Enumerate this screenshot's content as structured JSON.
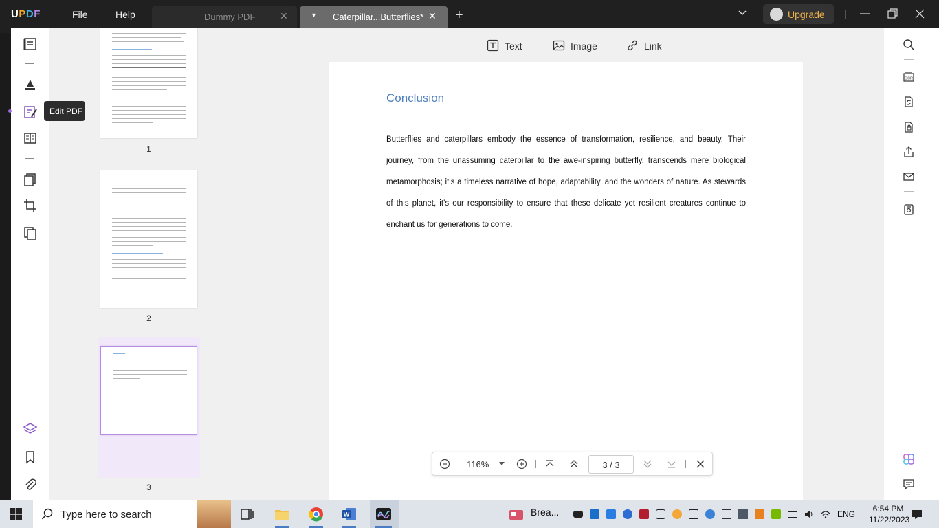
{
  "titlebar": {
    "logo": "UPDF",
    "menus": [
      "File",
      "Help"
    ],
    "tabs": [
      {
        "label": "Dummy PDF",
        "active": false
      },
      {
        "label": "Caterpillar...Butterflies*",
        "active": true
      }
    ],
    "upgrade_label": "Upgrade"
  },
  "rail": {
    "tooltip": "Edit PDF",
    "active_tool": "edit-pdf"
  },
  "thumbnails": {
    "pages": [
      "1",
      "2",
      "3"
    ],
    "selected": "3"
  },
  "toolbar": {
    "text_label": "Text",
    "image_label": "Image",
    "link_label": "Link"
  },
  "document": {
    "heading": "Conclusion",
    "body": "Butterflies and caterpillars embody the essence of transformation, resilience, and beauty. Their journey, from the unassuming caterpillar to the awe-inspiring butterfly, transcends mere biological metamorphosis; it’s a timeless narrative of hope, adaptability, and the wonders of nature. As stewards of this planet, it’s our responsibility to ensure that these delicate yet resilient creatures continue to enchant us for generations to come."
  },
  "navbar": {
    "zoom": "116%",
    "page_display": "3  /  3"
  },
  "taskbar": {
    "search_placeholder": "Type here to search",
    "pinned_label": "Brea...",
    "language": "ENG",
    "time": "6:54 PM",
    "date": "11/22/2023"
  },
  "colors": {
    "accent": "#9b6dd6",
    "heading": "#4f81bd",
    "upgrade": "#f2b24a"
  }
}
